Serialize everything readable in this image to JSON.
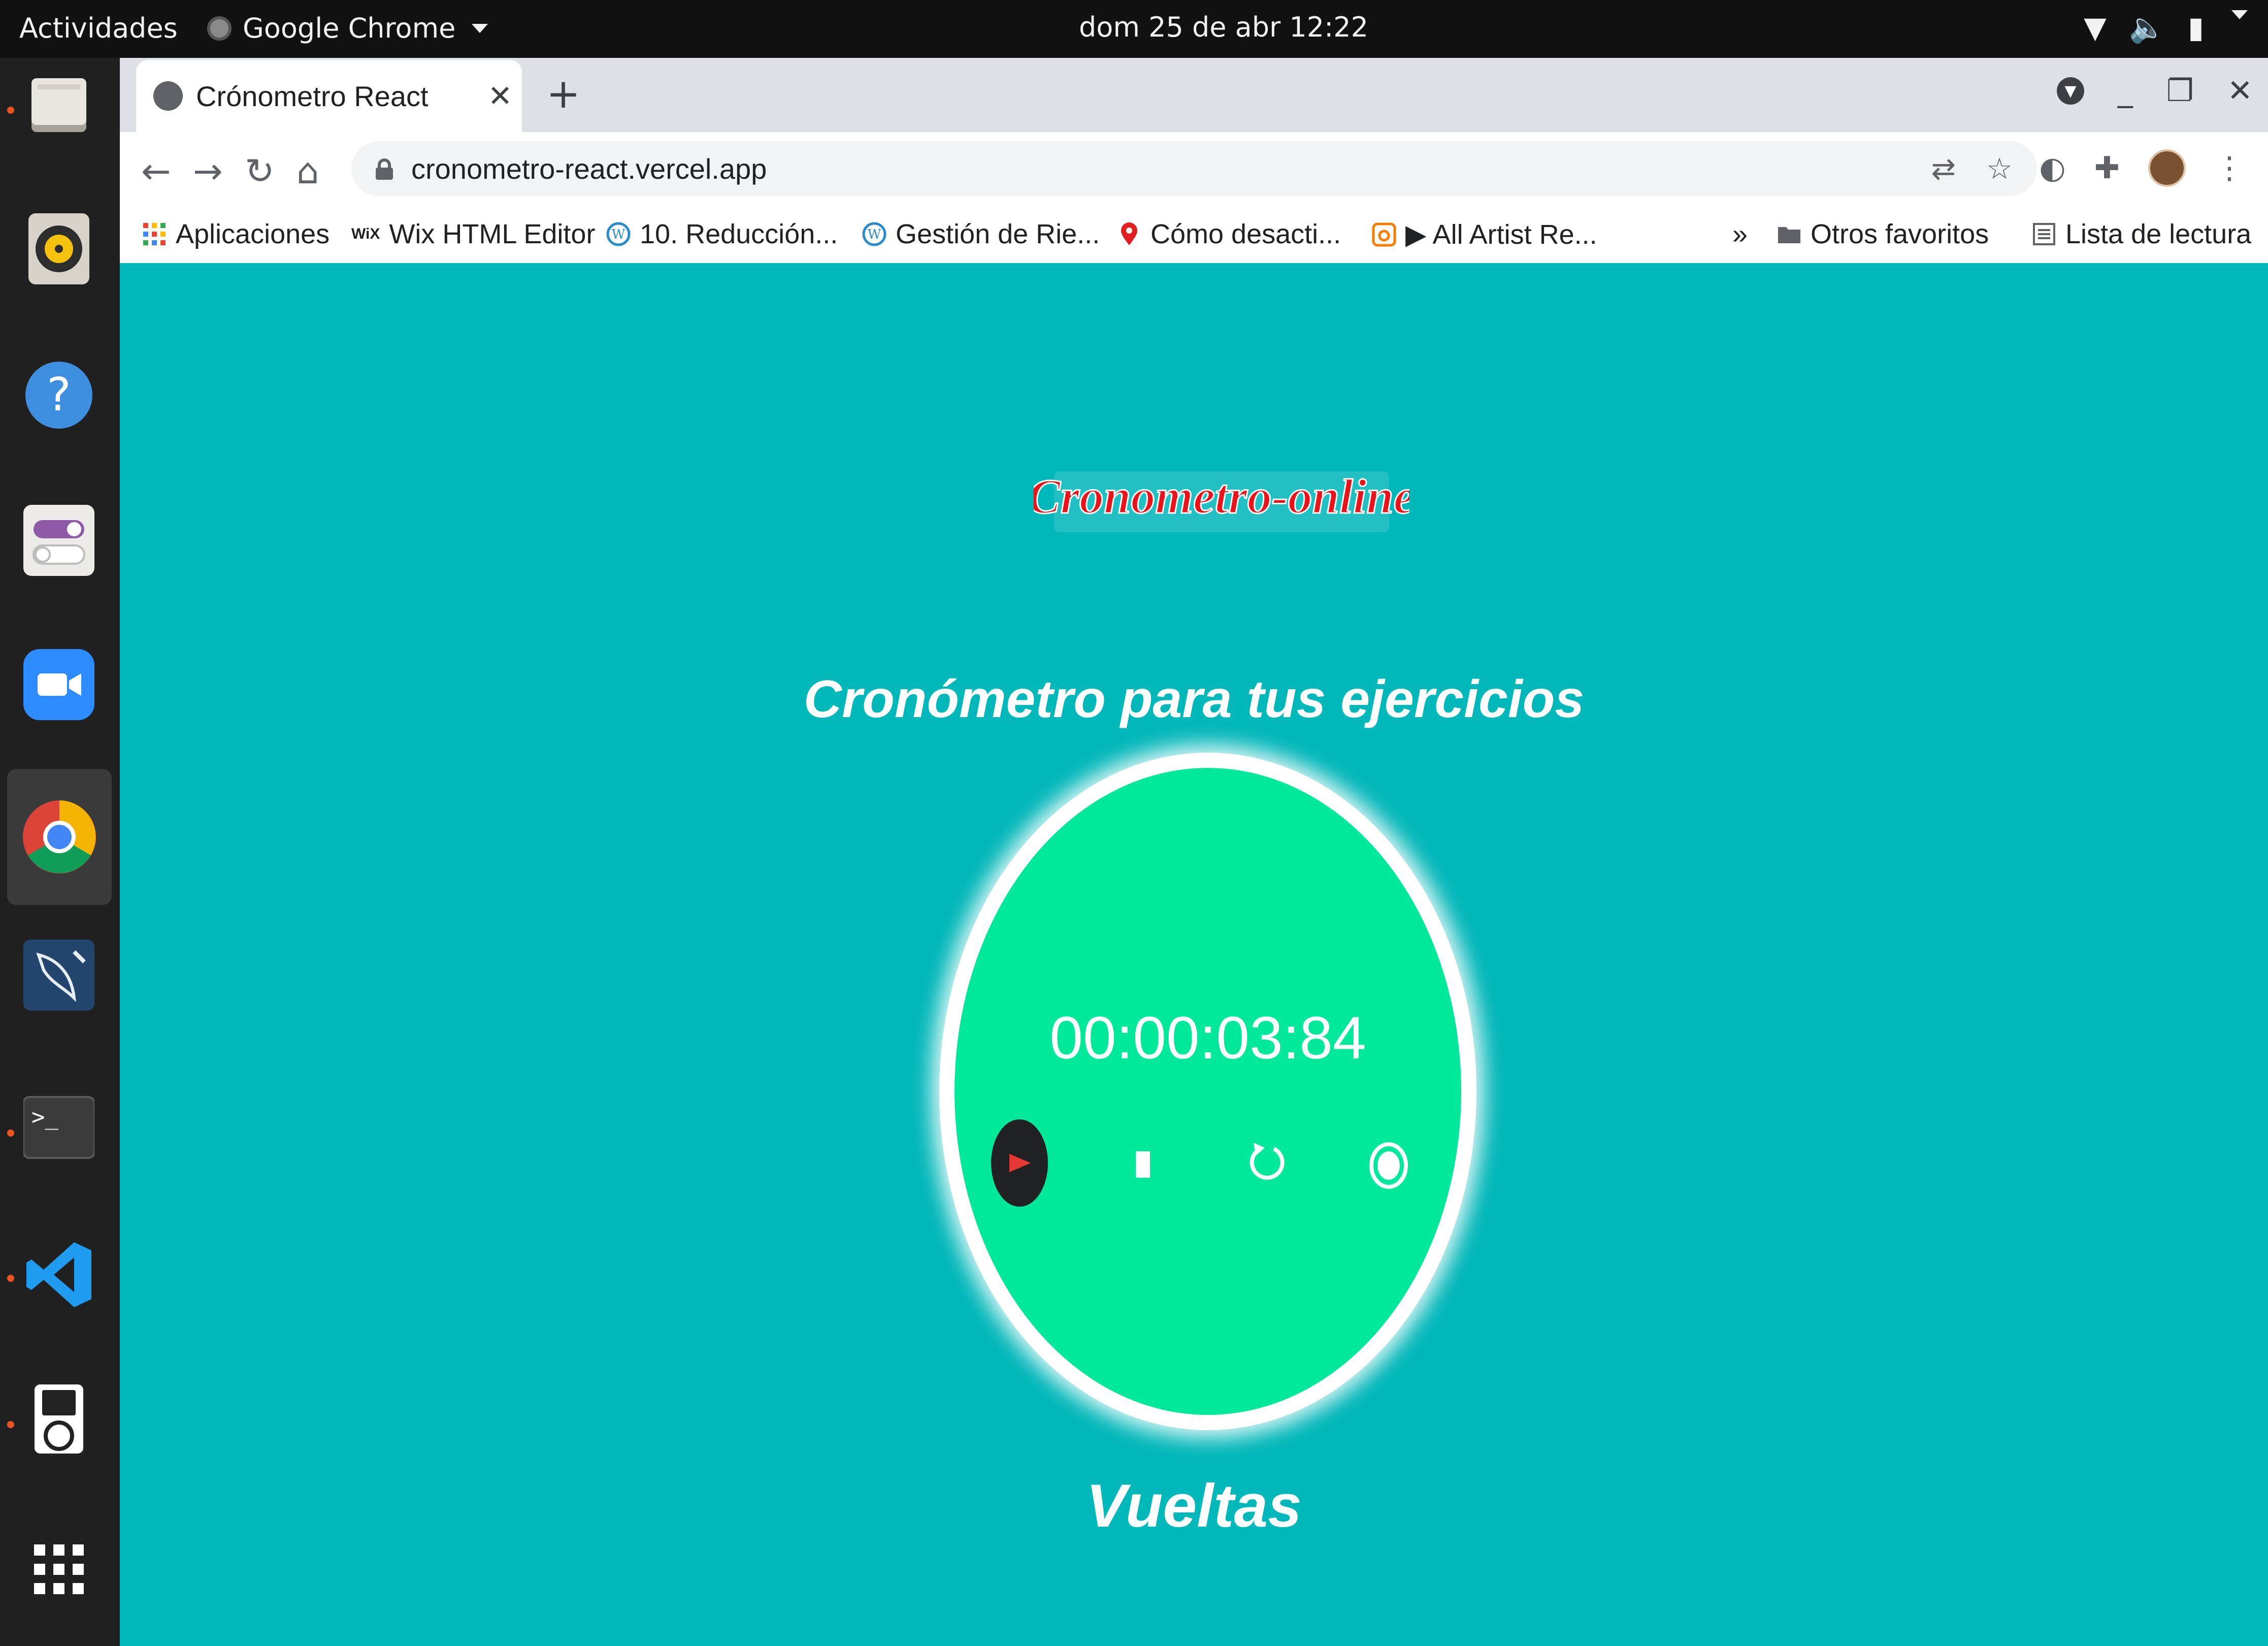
{
  "topbar": {
    "activities": "Actividades",
    "app_name": "Google Chrome",
    "clock": "dom 25 de abr  12:22",
    "tray_icons": [
      "wifi-icon",
      "volume-icon",
      "battery-icon",
      "system-menu-caret-icon"
    ]
  },
  "dock": {
    "items": [
      "files-icon",
      "rhythmbox-icon",
      "help-icon",
      "tweaks-icon",
      "zoom-icon",
      "chrome-icon",
      "mysql-workbench-icon",
      "terminal-icon",
      "vscode-icon",
      "ipod-icon",
      "app-grid-icon"
    ],
    "active": "chrome-icon"
  },
  "browser": {
    "tab_title": "Crónometro React",
    "new_tab": "+",
    "url": "cronometro-react.vercel.app",
    "bookmarks": [
      {
        "label": "Aplicaciones",
        "icon": "apps-grid-icon"
      },
      {
        "label": "Wix HTML Editor",
        "icon": "wix-icon"
      },
      {
        "label": "10. Reducción...",
        "icon": "wordpress-icon"
      },
      {
        "label": "Gestión de Rie...",
        "icon": "wordpress-icon"
      },
      {
        "label": "Cómo desacti...",
        "icon": "map-pin-icon"
      },
      {
        "label": "▶ All Artist Re...",
        "icon": "audio-icon"
      }
    ],
    "bookmarks_overflow": "»",
    "other_favorites": "Otros favoritos",
    "reading_list": "Lista de lectura",
    "colors": {
      "tabstrip": "#dee1e6",
      "toolbar": "#ffffff",
      "omnibox": "#f1f3f4"
    }
  },
  "page": {
    "logo_text": "Cronometro-online",
    "subtitle": "Cronómetro para tus ejercicios",
    "time": "00:00:03:84",
    "controls": [
      "play-icon",
      "stop-icon",
      "reset-icon",
      "lap-icon"
    ],
    "laps_heading": "Vueltas",
    "colors": {
      "background": "#00b7b9",
      "dial": "#00e89a",
      "logo_red": "#e8141c",
      "play_bg": "#202124",
      "play_fg": "#e53935"
    }
  }
}
